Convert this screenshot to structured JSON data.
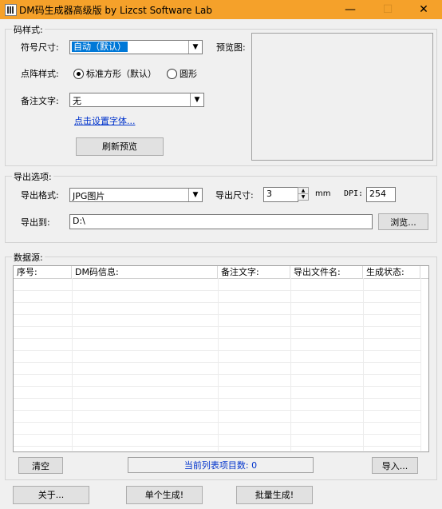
{
  "window": {
    "title": "DM码生成器高级版  by Lizcst Software Lab",
    "minimize": "—",
    "maximize": "☐",
    "close": "✕"
  },
  "style_group": {
    "title": "码样式:",
    "symbol_size_label": "符号尺寸:",
    "symbol_size_value": "自动（默认）",
    "dot_style_label": "点阵样式:",
    "dot_style_options": [
      "标准方形（默认）",
      "圆形"
    ],
    "dot_style_selected": "标准方形（默认）",
    "note_text_label": "备注文字:",
    "note_text_value": "无",
    "font_link": "点击设置字体...",
    "preview_label": "预览图:",
    "refresh_button": "刷新预览"
  },
  "export_group": {
    "title": "导出选项:",
    "format_label": "导出格式:",
    "format_value": "JPG图片",
    "size_label": "导出尺寸:",
    "size_value": "3",
    "size_unit": "mm",
    "dpi_label": "DPI:",
    "dpi_value": "254",
    "export_to_label": "导出到:",
    "export_to_value": "D:\\",
    "browse_button": "浏览..."
  },
  "data_group": {
    "title": "数据源:",
    "columns": [
      "序号:",
      "DM码信息:",
      "备注文字:",
      "导出文件名:",
      "生成状态:"
    ],
    "rows": [],
    "clear_button": "清空",
    "status_text": "当前列表项目数: 0",
    "import_button": "导入..."
  },
  "footer": {
    "about_button": "关于...",
    "single_button": "单个生成!",
    "batch_button": "批量生成!"
  },
  "colors": {
    "titlebar": "#f5a12a",
    "link": "#0033cc",
    "selection": "#0078d7"
  }
}
